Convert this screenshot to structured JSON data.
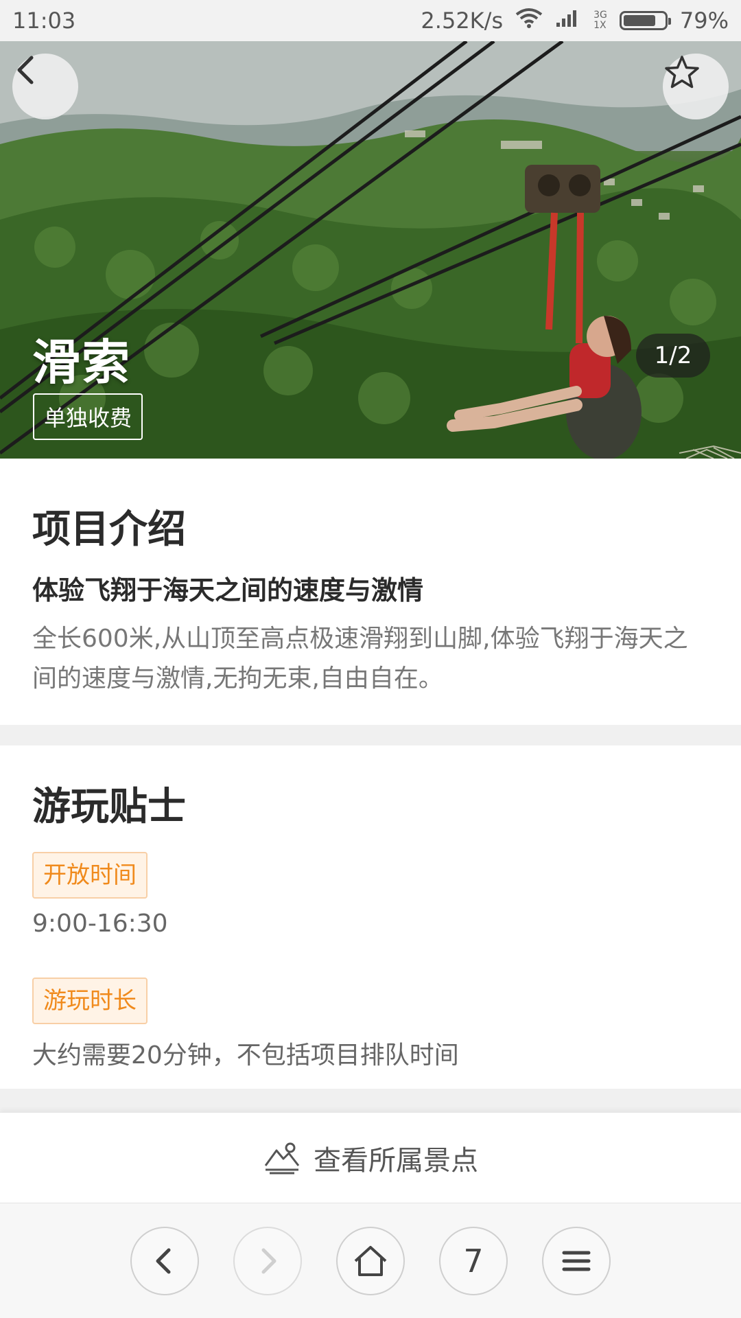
{
  "status_bar": {
    "time": "11:03",
    "speed": "2.52K/s",
    "net_top": "3G",
    "net_bottom": "1X",
    "battery": "79%",
    "battery_level": 0.79
  },
  "hero": {
    "title": "滑索",
    "tag": "单独收费",
    "counter": "1/2"
  },
  "intro": {
    "title": "项目介绍",
    "subtitle": "体验飞翔于海天之间的速度与激情",
    "body": "全长600米,从山顶至高点极速滑翔到山脚,体验飞翔于海天之间的速度与激情,无拘无束,自由自在。"
  },
  "tips": {
    "title": "游玩贴士",
    "items": [
      {
        "label": "开放时间",
        "value": "9:00-16:30"
      },
      {
        "label": "游玩时长",
        "value": "大约需要20分钟，不包括项目排队时间"
      }
    ]
  },
  "action_bar": {
    "label": "查看所属景点",
    "icon": "mountain-icon"
  },
  "browser_nav": {
    "tab_count": "7",
    "icons": [
      "back-icon",
      "forward-icon",
      "home-icon",
      "tabs-icon",
      "menu-icon"
    ]
  },
  "colors": {
    "accent_orange": "#f08a1c",
    "badge_bg": "#fff3e6",
    "divider": "#f0f0f0"
  }
}
